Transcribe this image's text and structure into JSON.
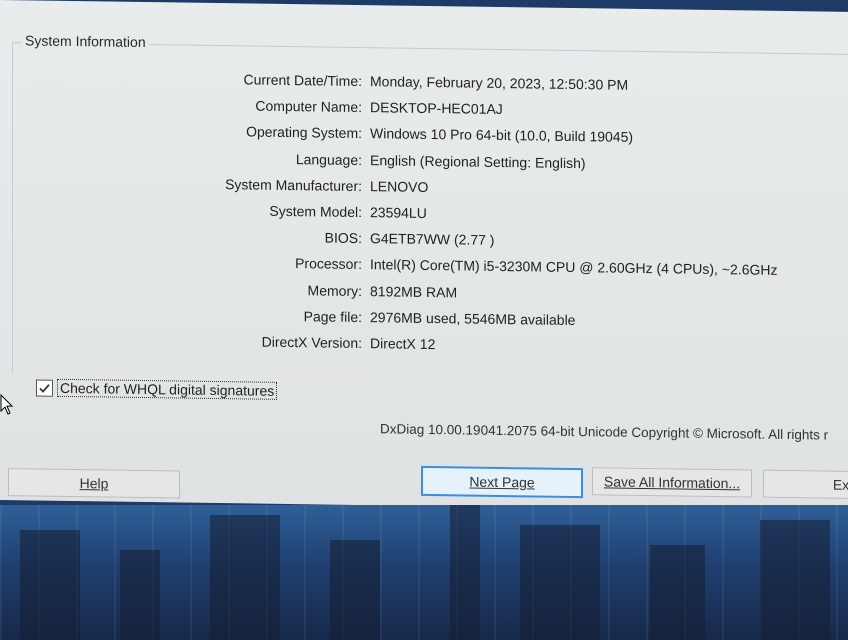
{
  "group": {
    "title": "System Information"
  },
  "info": [
    {
      "label": "Current Date/Time:",
      "value": "Monday, February 20, 2023, 12:50:30 PM"
    },
    {
      "label": "Computer Name:",
      "value": "DESKTOP-HEC01AJ"
    },
    {
      "label": "Operating System:",
      "value": "Windows 10 Pro 64-bit (10.0, Build 19045)"
    },
    {
      "label": "Language:",
      "value": "English (Regional Setting: English)"
    },
    {
      "label": "System Manufacturer:",
      "value": "LENOVO"
    },
    {
      "label": "System Model:",
      "value": "23594LU"
    },
    {
      "label": "BIOS:",
      "value": "G4ETB7WW (2.77 )"
    },
    {
      "label": "Processor:",
      "value": "Intel(R) Core(TM) i5-3230M CPU @ 2.60GHz (4 CPUs), ~2.6GHz"
    },
    {
      "label": "Memory:",
      "value": "8192MB RAM"
    },
    {
      "label": "Page file:",
      "value": "2976MB used, 5546MB available"
    },
    {
      "label": "DirectX Version:",
      "value": "DirectX 12"
    }
  ],
  "whql": {
    "label": "Check for WHQL digital signatures",
    "checked": true
  },
  "footer": {
    "text": "DxDiag 10.00.19041.2075 64-bit Unicode  Copyright © Microsoft. All rights r"
  },
  "buttons": {
    "help": "Help",
    "next_page": "Next Page",
    "save_all": "Save All Information...",
    "exit": "Ex"
  },
  "icons": {
    "check": "checkmark-icon",
    "cursor": "mouse-cursor-icon"
  }
}
